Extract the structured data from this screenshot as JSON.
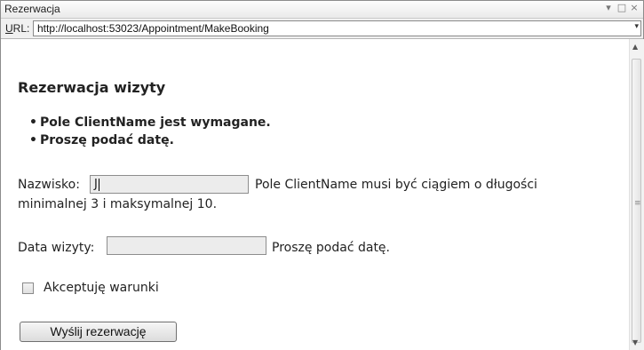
{
  "window": {
    "title": "Rezerwacja",
    "controls": {
      "dropdown": "▾",
      "maximize": "□",
      "close": "×"
    }
  },
  "address_bar": {
    "label_underlined": "U",
    "label_rest": "RL:",
    "url": "http://localhost:53023/Appointment/MakeBooking",
    "dropdown_glyph": "▾"
  },
  "page": {
    "title": "Rezerwacja wizyty",
    "validation_summary": [
      "Pole ClientName jest wymagane.",
      "Proszę podać datę."
    ],
    "bullet": "•",
    "name_field": {
      "label": "Nazwisko:",
      "value": "J",
      "error_line1": "Pole ClientName musi być ciągiem o długości",
      "error_line2": "minimalnej 3 i maksymalnej 10."
    },
    "date_field": {
      "label": "Data wizyty:",
      "value": "",
      "error": "Proszę podać datę."
    },
    "terms": {
      "label": "Akceptuję warunki",
      "checked": false
    },
    "submit_label": "Wyślij rezerwację"
  },
  "scrollbar": {
    "up": "▲",
    "down": "▼",
    "grip": "≡"
  }
}
